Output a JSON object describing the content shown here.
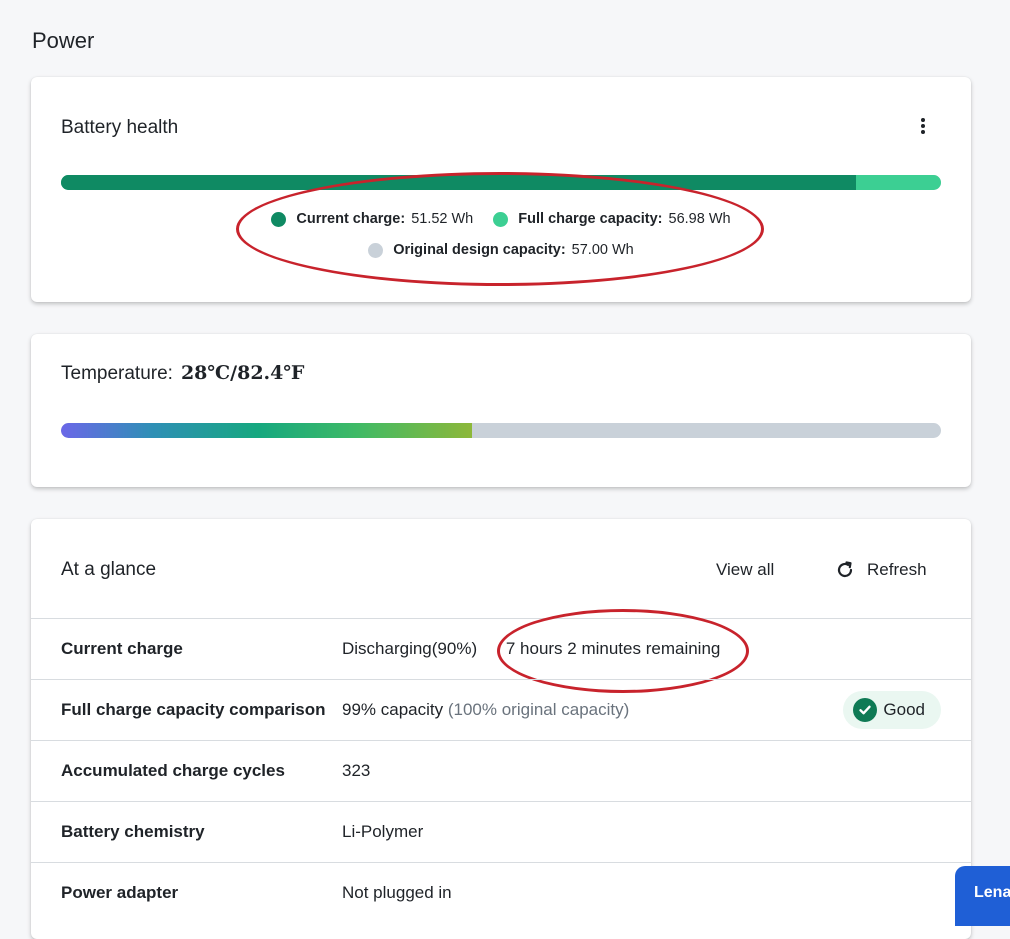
{
  "page": {
    "title": "Power"
  },
  "battery_health": {
    "title": "Battery health",
    "menu_icon": "kebab-vertical-icon",
    "current_charge_wh": 51.52,
    "full_charge_capacity_wh": 56.98,
    "design_capacity_wh": 57.0,
    "legend": {
      "current_label": "Current charge:",
      "current_value": "51.52 Wh",
      "full_label": "Full charge capacity:",
      "full_value": "56.98 Wh",
      "design_label": "Original design capacity:",
      "design_value": "57.00 Wh"
    },
    "colors": {
      "current": "#0f8a63",
      "full": "#3ccf93",
      "design": "#c9d1d9"
    }
  },
  "temperature": {
    "label": "Temperature:",
    "value": "28℃/82.4℉",
    "level_fraction": 0.467
  },
  "at_a_glance": {
    "title": "At a glance",
    "view_all": "View all",
    "refresh": "Refresh",
    "refresh_icon": "refresh-icon",
    "rows": [
      {
        "label": "Current charge",
        "value": "Discharging(90%)",
        "extra": "7 hours 2 minutes remaining"
      },
      {
        "label": "Full charge capacity comparison",
        "value": "99% capacity",
        "muted": "(100% original capacity)",
        "badge": "Good",
        "badge_icon": "check-circle-icon"
      },
      {
        "label": "Accumulated charge cycles",
        "value": "323"
      },
      {
        "label": "Battery chemistry",
        "value": "Li-Polymer"
      },
      {
        "label": "Power adapter",
        "value": "Not plugged in"
      }
    ]
  },
  "assistant_button": {
    "label": "Lena"
  },
  "annotation_color": "#c8232c"
}
